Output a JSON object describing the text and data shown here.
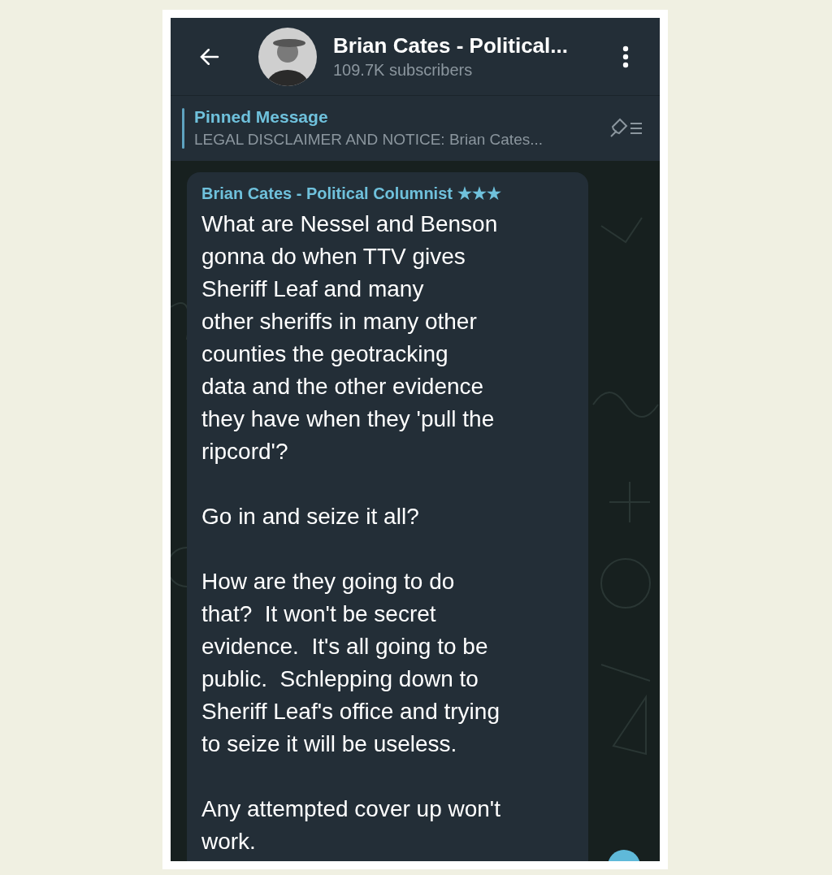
{
  "header": {
    "title": "Brian Cates - Political...",
    "subtitle": "109.7K subscribers"
  },
  "pinned": {
    "label": "Pinned Message",
    "text": "LEGAL DISCLAIMER AND NOTICE: Brian Cates..."
  },
  "message": {
    "author": "Brian Cates - Political Columnist ★★★",
    "paragraphs": [
      "What are Nessel and Benson\ngonna do when TTV gives\nSheriff Leaf and many\nother sheriffs in many other\ncounties the geotracking\ndata and the other evidence\nthey have when they 'pull the\nripcord'?",
      "Go in and seize it all?",
      "How are they going to do\nthat?  It won't be secret\nevidence.  It's all going to be\npublic.  Schlepping down to\nSheriff Leaf's office and trying\nto seize it will be useless.",
      "Any attempted cover up won't\nwork."
    ]
  }
}
